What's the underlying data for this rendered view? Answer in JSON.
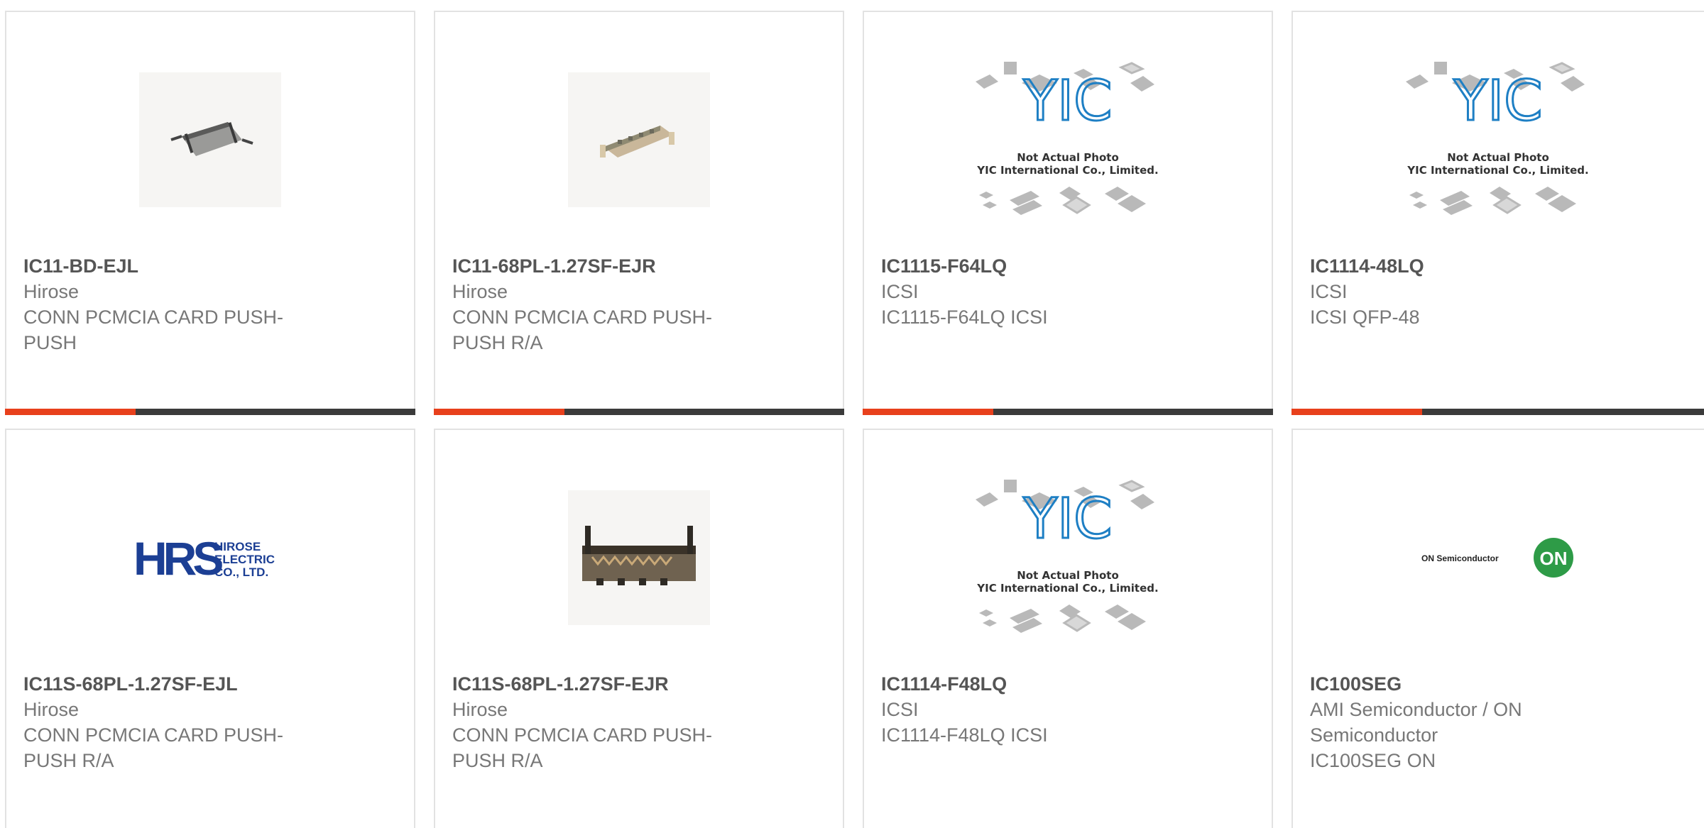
{
  "colors": {
    "accent": "#e8401c",
    "bar": "#3b3b3b",
    "border": "#e2e2e2",
    "part_number": "#555555",
    "secondary_text": "#777777",
    "hrs_blue": "#1c3f94",
    "on_green": "#2e9b47"
  },
  "placeholder_logo": {
    "brand": "YIC",
    "line1": "Not Actual Photo",
    "line2": "YIC International Co., Limited."
  },
  "hirose_logo": {
    "brand": "HRS",
    "line1": "HIROSE",
    "line2": "ELECTRIC",
    "line3": "CO., LTD."
  },
  "on_logo": {
    "wordmark": "ON Semiconductor",
    "badge": "ON"
  },
  "products": [
    {
      "part_number": "IC11-BD-EJL",
      "manufacturer": "Hirose",
      "description": "CONN PCMCIA CARD PUSH-PUSH",
      "image": "pcmcia-connector-photo"
    },
    {
      "part_number": "IC11-68PL-1.27SF-EJR",
      "manufacturer": "Hirose",
      "description": "CONN PCMCIA CARD PUSH-PUSH R/A",
      "image": "pcmcia-connector-photo"
    },
    {
      "part_number": "IC1115-F64LQ",
      "manufacturer": "ICSI",
      "description": "IC1115-F64LQ ICSI",
      "image": "yic-placeholder"
    },
    {
      "part_number": "IC1114-48LQ",
      "manufacturer": "ICSI",
      "description": "ICSI QFP-48",
      "image": "yic-placeholder"
    },
    {
      "part_number": "IC11S-68PL-1.27SF-EJL",
      "manufacturer": "Hirose",
      "description": "CONN PCMCIA CARD PUSH-PUSH R/A",
      "image": "hirose-logo"
    },
    {
      "part_number": "IC11S-68PL-1.27SF-EJR",
      "manufacturer": "Hirose",
      "description": "CONN PCMCIA CARD PUSH-PUSH R/A",
      "image": "pcmcia-connector-photo"
    },
    {
      "part_number": "IC1114-F48LQ",
      "manufacturer": "ICSI",
      "description": "IC1114-F48LQ ICSI",
      "image": "yic-placeholder"
    },
    {
      "part_number": "IC100SEG",
      "manufacturer": "AMI Semiconductor / ON Semiconductor",
      "description": "IC100SEG ON",
      "image": "on-semiconductor-logo"
    }
  ]
}
